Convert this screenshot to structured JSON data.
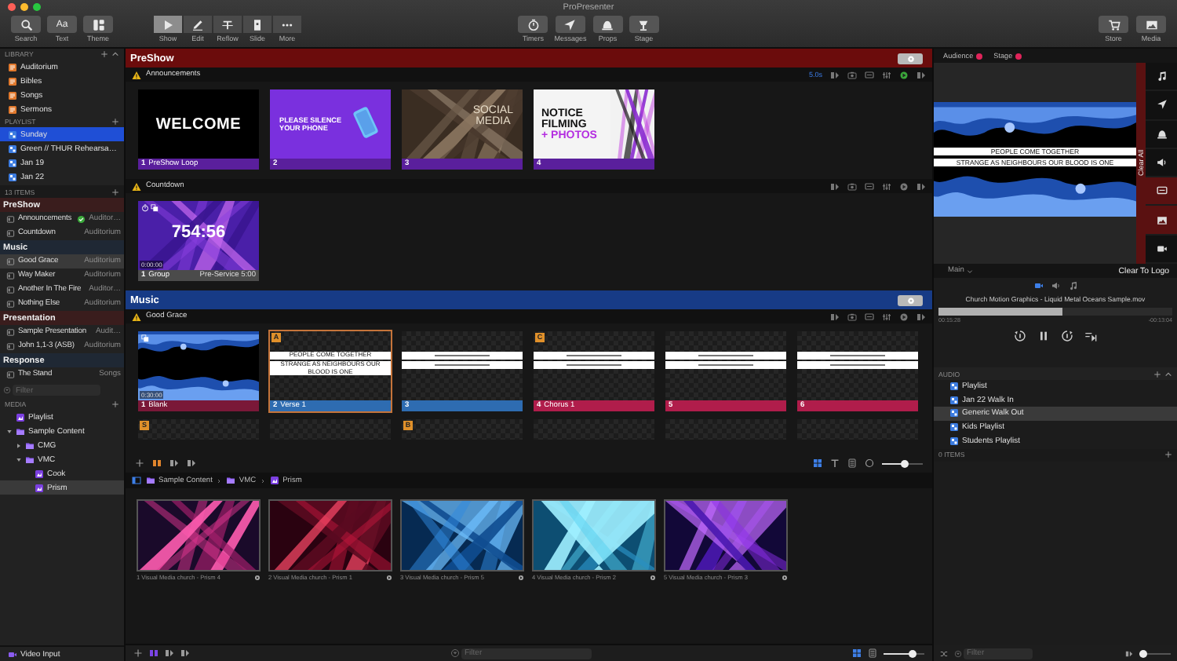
{
  "window": {
    "title": "ProPresenter"
  },
  "toolbar": {
    "left": [
      {
        "label": "Search"
      },
      {
        "label": "Text",
        "glyph": "Aa"
      },
      {
        "label": "Theme"
      }
    ],
    "modes": [
      {
        "label": "Show",
        "selected": true
      },
      {
        "label": "Edit",
        "selected": false
      },
      {
        "label": "Reflow",
        "selected": false
      },
      {
        "label": "Slide",
        "selected": false
      },
      {
        "label": "More",
        "selected": false
      }
    ],
    "center": [
      {
        "label": "Timers"
      },
      {
        "label": "Messages"
      },
      {
        "label": "Props"
      },
      {
        "label": "Stage"
      }
    ],
    "right": [
      {
        "label": "Store"
      },
      {
        "label": "Media"
      }
    ]
  },
  "sidebar": {
    "library": {
      "title": "LIBRARY",
      "items": [
        {
          "label": "Auditorium"
        },
        {
          "label": "Bibles"
        },
        {
          "label": "Songs"
        },
        {
          "label": "Sermons"
        }
      ]
    },
    "playlist": {
      "title": "PLAYLIST",
      "items": [
        {
          "label": "Sunday",
          "selected": true
        },
        {
          "label": "Green // THUR Rehearsa…",
          "selected": false
        },
        {
          "label": "Jan 19",
          "selected": false
        },
        {
          "label": "Jan 22",
          "selected": false
        }
      ]
    },
    "count": "13 ITEMS",
    "groups": [
      {
        "name": "PreShow",
        "color": "#3a1d1d",
        "items": [
          {
            "name": "Announcements",
            "screen": "Auditor…",
            "live": true,
            "selected": false
          },
          {
            "name": "Countdown",
            "screen": "Auditorium",
            "live": false,
            "selected": false
          }
        ]
      },
      {
        "name": "Music",
        "color": "#1f2834",
        "items": [
          {
            "name": "Good Grace",
            "screen": "Auditorium",
            "live": false,
            "selected": true
          },
          {
            "name": "Way Maker",
            "screen": "Auditorium",
            "live": false,
            "selected": false
          },
          {
            "name": "Another In The Fire",
            "screen": "Auditor…",
            "live": false,
            "selected": false
          },
          {
            "name": "Nothing Else",
            "screen": "Auditorium",
            "live": false,
            "selected": false
          }
        ]
      },
      {
        "name": "Presentation",
        "color": "#3a1d1d",
        "items": [
          {
            "name": "Sample Presentation",
            "screen": "Audit…",
            "live": false,
            "selected": false
          },
          {
            "name": "John 1,1-3 (ASB)",
            "screen": "Auditorium",
            "live": false,
            "selected": false
          }
        ]
      },
      {
        "name": "Response",
        "color": "#1f2834",
        "items": [
          {
            "name": "The Stand",
            "screen": "Songs",
            "live": false,
            "selected": false
          }
        ]
      }
    ],
    "filter": {
      "placeholder": "Filter"
    },
    "media": {
      "title": "MEDIA",
      "tree": [
        {
          "label": "Playlist",
          "kind": "playlist",
          "selected": false
        },
        {
          "label": "Sample Content",
          "kind": "folder",
          "expanded": true,
          "selected": false,
          "children": [
            {
              "label": "CMG",
              "kind": "folder",
              "expanded": false,
              "selected": false
            },
            {
              "label": "VMC",
              "kind": "folder",
              "expanded": true,
              "selected": false,
              "children": [
                {
                  "label": "Cook",
                  "kind": "playlist",
                  "selected": false
                },
                {
                  "label": "Prism",
                  "kind": "playlist",
                  "selected": true
                }
              ]
            }
          ]
        }
      ]
    },
    "video_input": "Video Input"
  },
  "presentations": [
    {
      "group": "PreShow",
      "color": "#6b0c0c",
      "docs": [
        {
          "title": "Announcements",
          "timer": "5.0s",
          "slides": [
            {
              "kind": "title",
              "number": "1",
              "label": "PreShow Loop",
              "color": "#5a1f9c",
              "selected": false,
              "text": [
                "WELCOME"
              ]
            },
            {
              "kind": "phone",
              "number": "2",
              "color": "#5a1f9c",
              "selected": false,
              "text": [
                "PLEASE SILENCE",
                "YOUR PHONE"
              ]
            },
            {
              "number": "3",
              "color": "#5a1f9c",
              "selected": false,
              "text": [
                "SOCIAL",
                "MEDIA"
              ]
            },
            {
              "kind": "poster",
              "number": "4",
              "color": "#5a1f9c",
              "selected": false,
              "text": [
                "NOTICE",
                "FILMING",
                "+ PHOTOS"
              ]
            }
          ]
        },
        {
          "title": "Countdown",
          "slides": [
            {
              "kind": "countdown",
              "number": "1",
              "label": "Group",
              "note": "Pre-Service 5:00",
              "color": "#4b4b4b",
              "selected": false,
              "time": "0:00:00",
              "text": [
                "754:56"
              ]
            }
          ]
        }
      ]
    },
    {
      "group": "Music",
      "color": "#173b86",
      "docs": [
        {
          "title": "Good Grace",
          "slides": [
            {
              "kind": "video",
              "number": "1",
              "label": "Blank",
              "color": "#7a1838",
              "selected": false,
              "time": "0:30:00"
            },
            {
              "kind": "lyrics",
              "number": "2",
              "label": "Verse 1",
              "color": "#2e6cb1",
              "hotkey": "A",
              "selected": true,
              "text": [
                "PEOPLE COME TOGETHER",
                "STRANGE AS NEIGHBOURS OUR BLOOD IS ONE"
              ]
            },
            {
              "kind": "lyrics",
              "number": "3",
              "color": "#2e6cb1",
              "selected": false
            },
            {
              "kind": "lyrics",
              "number": "4",
              "label": "Chorus 1",
              "color": "#b01d4b",
              "hotkey": "C",
              "selected": false
            },
            {
              "kind": "lyrics",
              "number": "5",
              "color": "#b01d4b",
              "selected": false
            },
            {
              "kind": "lyrics",
              "number": "6",
              "color": "#b01d4b",
              "selected": false
            },
            {
              "kind": "partial",
              "hotkey": "S",
              "selected": false
            },
            {
              "kind": "partial",
              "selected": false
            },
            {
              "kind": "partial",
              "hotkey": "B",
              "selected": false
            },
            {
              "kind": "partial",
              "selected": false
            },
            {
              "kind": "partial",
              "selected": false
            },
            {
              "kind": "partial",
              "selected": false
            }
          ]
        }
      ]
    }
  ],
  "slide_zoom": {
    "level": 0.55
  },
  "breadcrumb": [
    {
      "label": "Sample Content",
      "kind": "folder"
    },
    {
      "label": "VMC",
      "kind": "folder"
    },
    {
      "label": "Prism",
      "kind": "playlist"
    }
  ],
  "media_items": [
    {
      "number": "1",
      "label": "Visual Media church - Prism 4"
    },
    {
      "number": "2",
      "label": "Visual Media church - Prism 1"
    },
    {
      "number": "3",
      "label": "Visual Media church - Prism 5"
    },
    {
      "number": "4",
      "label": "Visual Media church - Prism 2"
    },
    {
      "number": "5",
      "label": "Visual Media church - Prism 3"
    }
  ],
  "media_bar": {
    "filter": {
      "placeholder": "Filter"
    },
    "zoom": {
      "level": 0.72
    }
  },
  "output": {
    "tabs": [
      {
        "label": "Audience",
        "live": true
      },
      {
        "label": "Stage",
        "live": true
      }
    ],
    "preview": {
      "lines": [
        "PEOPLE COME TOGETHER",
        "STRANGE AS NEIGHBOURS OUR BLOOD IS ONE"
      ]
    },
    "clear_all": "Clear All",
    "screen": "Main",
    "clear_logo": "Clear To Logo",
    "media_tabs": [
      {
        "selected": true
      },
      {
        "selected": false
      },
      {
        "selected": false
      }
    ],
    "now_playing": "Church Motion Graphics - Liquid Metal Oceans Sample.mov",
    "progress": {
      "level": 0.53
    },
    "elapsed": "00:15:28",
    "remaining": "-00:13:04",
    "playing": true,
    "audio": {
      "title": "AUDIO",
      "items": [
        {
          "label": "Playlist",
          "selected": false
        },
        {
          "label": "Jan 22 Walk In",
          "selected": false
        },
        {
          "label": "Generic Walk Out",
          "selected": true
        },
        {
          "label": "Kids Playlist",
          "selected": false
        },
        {
          "label": "Students Playlist",
          "selected": false
        }
      ],
      "count": "0 ITEMS",
      "filter": {
        "placeholder": "Filter"
      },
      "volume": {
        "level": 0.1
      }
    }
  }
}
